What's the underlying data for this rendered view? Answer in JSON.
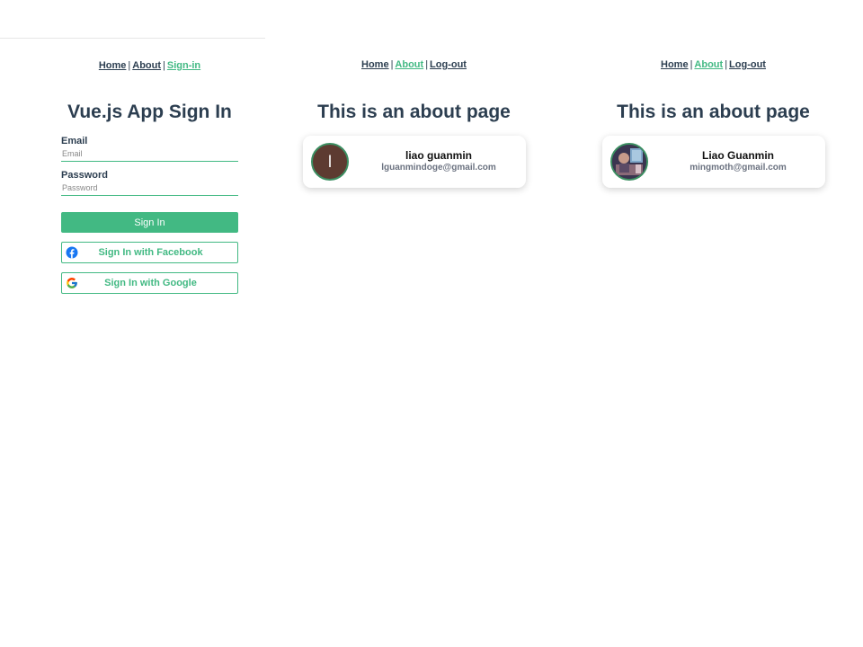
{
  "panels": {
    "signin": {
      "nav": [
        {
          "label": "Home",
          "active": false
        },
        {
          "label": "About",
          "active": false
        },
        {
          "label": "Sign-in",
          "active": true
        }
      ],
      "separator": "|",
      "title": "Vue.js App Sign In",
      "email": {
        "label": "Email",
        "placeholder": "Email",
        "value": ""
      },
      "password": {
        "label": "Password",
        "placeholder": "Password",
        "value": ""
      },
      "signin_button": "Sign In",
      "facebook_button": {
        "label": "Sign In with Facebook",
        "icon": "facebook-icon"
      },
      "google_button": {
        "label": "Sign In with Google",
        "icon": "google-icon"
      }
    },
    "about1": {
      "nav": [
        {
          "label": "Home",
          "active": false
        },
        {
          "label": "About",
          "active": true
        },
        {
          "label": "Log-out",
          "active": false
        }
      ],
      "title": "This is an about page",
      "user": {
        "avatar_letter": "l",
        "avatar_type": "letter-avatar",
        "name": "liao guanmin",
        "email": "lguanmindoge@gmail.com"
      }
    },
    "about2": {
      "nav": [
        {
          "label": "Home",
          "active": false
        },
        {
          "label": "About",
          "active": true
        },
        {
          "label": "Log-out",
          "active": false
        }
      ],
      "title": "This is an about page",
      "user": {
        "avatar_type": "photo-avatar",
        "name": "Liao Guanmin",
        "email": "mingmoth@gmail.com"
      }
    }
  },
  "colors": {
    "accent": "#42b983",
    "text": "#2c3e50",
    "letter_avatar_bg": "#5d3b31"
  }
}
